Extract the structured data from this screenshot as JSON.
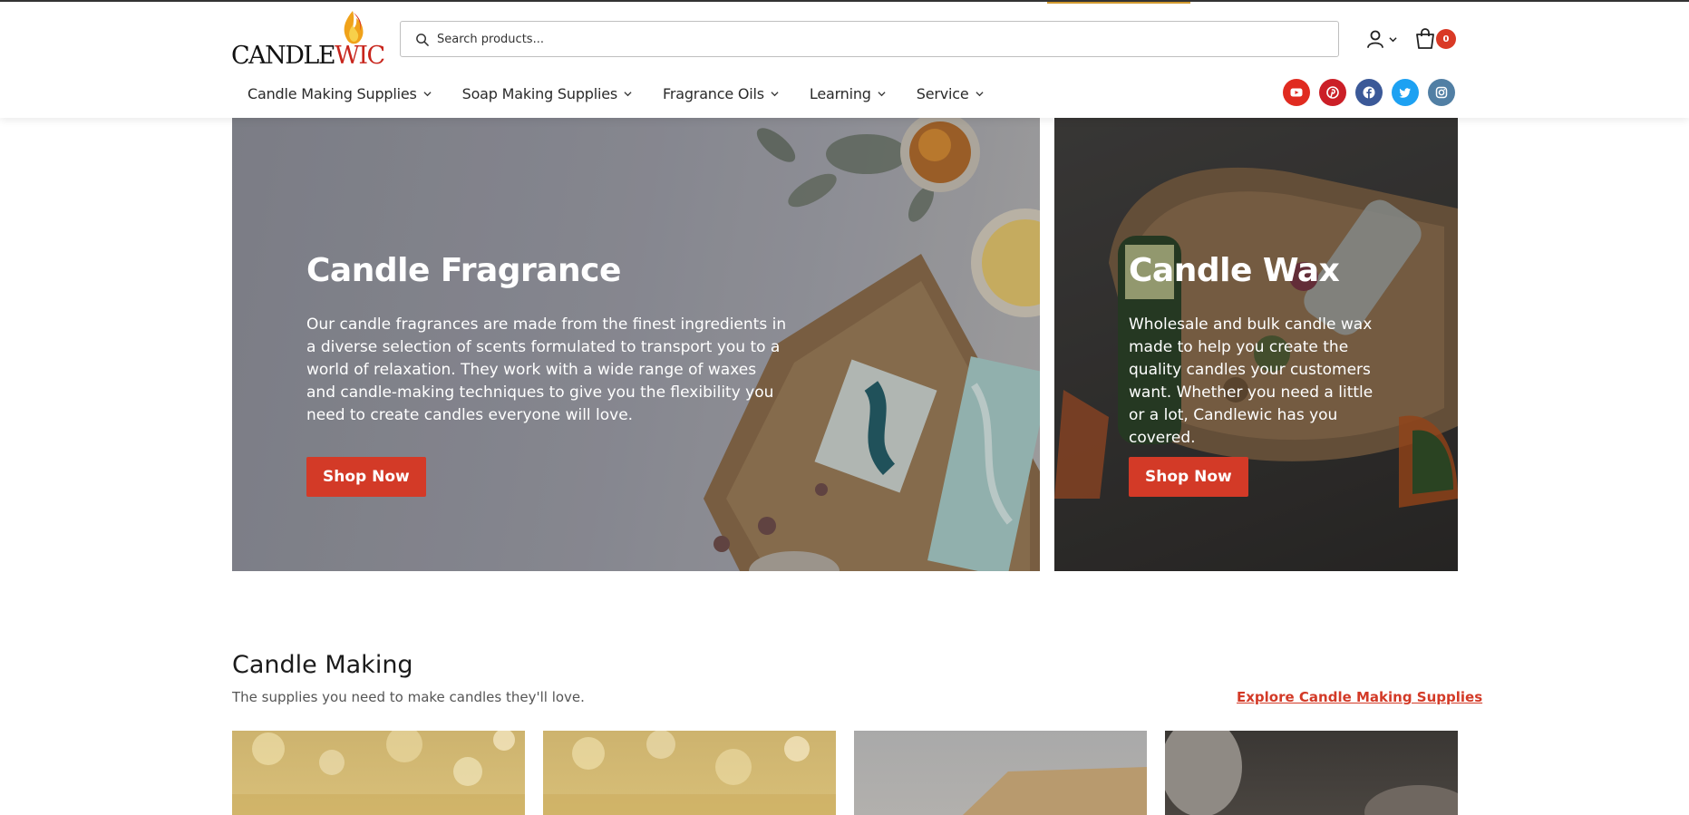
{
  "brand": {
    "logo_text_black": "CANDLE",
    "logo_text_red": "WIC",
    "accent": "#d33a27"
  },
  "search": {
    "placeholder": "Search products..."
  },
  "cart": {
    "count": "0"
  },
  "nav": {
    "items": [
      {
        "label": "Candle Making Supplies"
      },
      {
        "label": "Soap Making Supplies"
      },
      {
        "label": "Fragrance Oils"
      },
      {
        "label": "Learning"
      },
      {
        "label": "Service"
      }
    ]
  },
  "social": [
    {
      "icon": "youtube-icon",
      "color": "#e02b20"
    },
    {
      "icon": "pinterest-icon",
      "color": "#cb1f27"
    },
    {
      "icon": "facebook-icon",
      "color": "#3b5998"
    },
    {
      "icon": "twitter-icon",
      "color": "#1da1f2"
    },
    {
      "icon": "instagram-icon",
      "color": "#517fa4"
    }
  ],
  "hero_left": {
    "title": "Candle Fragrance",
    "text": "Our candle fragrances are made from the finest ingredients in a diverse selection of scents formulated to transport you to a world of relaxation. They work with a wide range of waxes and candle-making techniques to give you the flexibility you need to create candles everyone will love.",
    "button": "Shop Now"
  },
  "hero_right": {
    "title": "Candle Wax",
    "text": "Wholesale and bulk candle wax made to help you create the quality candles your customers want. Whether you need a little or a lot, Candlewic has you covered.",
    "button": "Shop Now"
  },
  "candle_making": {
    "title": "Candle Making",
    "subtitle": "The supplies you need to make candles they'll love.",
    "explore_link": "Explore Candle Making Supplies"
  }
}
